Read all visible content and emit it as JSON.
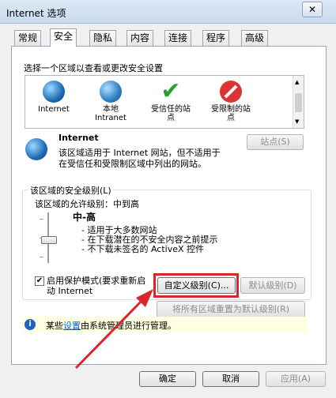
{
  "window": {
    "title": "Internet 选项",
    "close": "✕"
  },
  "tabs": [
    "常规",
    "安全",
    "隐私",
    "内容",
    "连接",
    "程序",
    "高级"
  ],
  "security": {
    "select_zone_prompt": "选择一个区域以查看或更改安全设置",
    "zones": [
      {
        "label": "Internet",
        "icon": "globe-icon"
      },
      {
        "label": "本地\nIntranet",
        "icon": "intranet-icon"
      },
      {
        "label": "受信任的站\n点",
        "icon": "checkmark-icon"
      },
      {
        "label": "受限制的站\n点",
        "icon": "no-entry-icon"
      }
    ],
    "selected_zone": {
      "name": "Internet",
      "description_line1": "该区域适用于 Internet 网站，但不适用于",
      "description_line2": "在受信任和受限制区域中列出的网站。",
      "sites_button": "站点(S)"
    },
    "level_group": {
      "title": "该区域的安全级别(L)",
      "allowed": "该区域的允许级别：中到高",
      "level_name": "中-高",
      "bullets": [
        "- 适用于大多数网站",
        "- 在下载潜在的不安全内容之前提示",
        "- 不下载未签名的 ActiveX 控件"
      ],
      "protected_mode_label": "启用保护模式(要求重新启动 Internet",
      "protected_mode_checked": true,
      "custom_level_button": "自定义级别(C)...",
      "default_level_button": "默认级别(D)"
    },
    "reset_all_button": "将所有区域重置为默认级别(R)",
    "info": {
      "prefix": "某些",
      "link": "设置",
      "suffix": "由系统管理员进行管理。"
    }
  },
  "footer": {
    "ok": "确定",
    "cancel": "取消",
    "apply": "应用(A)"
  },
  "annotation_color": "#d9262b"
}
